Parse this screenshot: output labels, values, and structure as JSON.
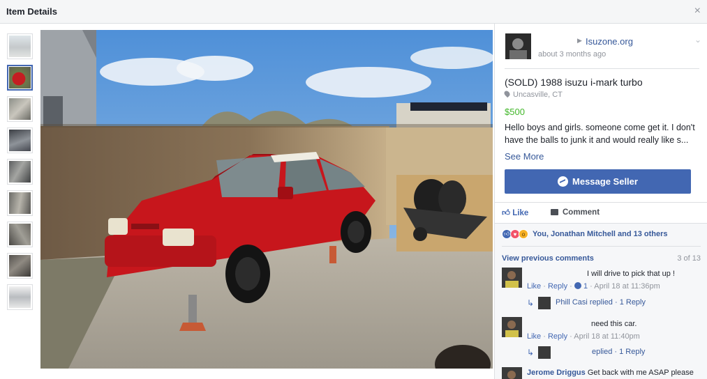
{
  "header": {
    "title": "Item Details",
    "close_symbol": "×"
  },
  "thumbnails": {
    "count": 9,
    "selected_index": 1
  },
  "seller": {
    "name": "Isuzone.org",
    "posted": "about 3 months ago"
  },
  "item": {
    "title": "(SOLD) 1988 isuzu i-mark turbo",
    "location": "Uncasville, CT",
    "price": "$500",
    "description": "Hello boys and girls. someone come get it. I don't have the balls to junk it and would really like s...",
    "see_more": "See More"
  },
  "message_button": "Message Seller",
  "actions": {
    "like": "Like",
    "comment": "Comment"
  },
  "reactions": {
    "text": "You, Jonathan Mitchell and 13 others"
  },
  "comments_meta": {
    "view_previous": "View previous comments",
    "count": "3 of 13"
  },
  "comments": [
    {
      "text": "I will drive to pick that up !",
      "like": "Like",
      "reply": "Reply",
      "likes": "1",
      "time": "April 18 at 11:36pm",
      "reply_summary": "Phill Casi replied · 1 Reply"
    },
    {
      "text": "need this car.",
      "like": "Like",
      "reply": "Reply",
      "time": "April 18 at 11:40pm",
      "reply_summary": "eplied · 1 Reply"
    },
    {
      "author": "Jerome Driggus",
      "text": "Get back with me ASAP please"
    }
  ],
  "colors": {
    "accent": "#4267b2",
    "price": "#42b72a",
    "link": "#365899"
  }
}
